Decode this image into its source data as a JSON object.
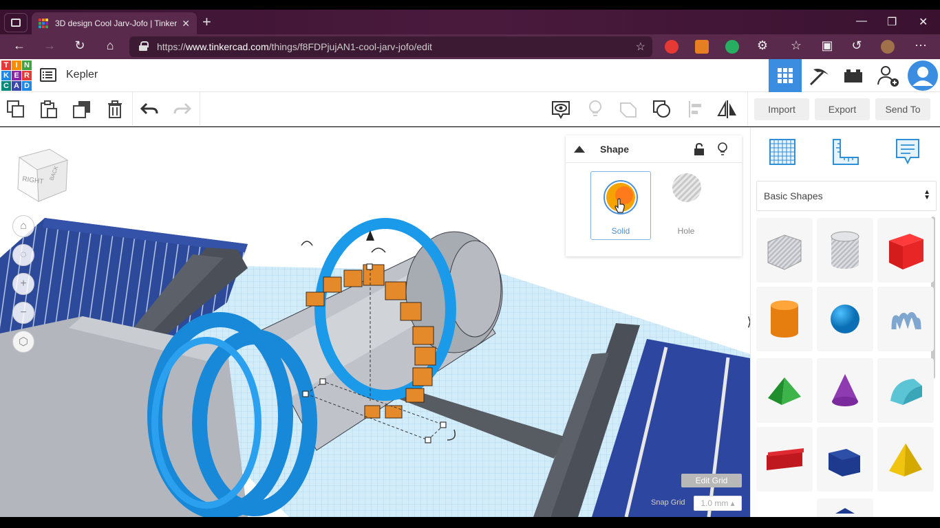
{
  "browser": {
    "tab_title": "3D design Cool Jarv-Jofo | Tinker",
    "url_prefix": "https://",
    "url_domain": "www.tinkercad.com",
    "url_path": "/things/f8FDPjujAN1-cool-jarv-jofo/edit"
  },
  "app": {
    "logo_letters": [
      "T",
      "I",
      "N",
      "K",
      "E",
      "R",
      "C",
      "A",
      "D"
    ],
    "design_name": "Kepler"
  },
  "toolbar": {
    "import_label": "Import",
    "export_label": "Export",
    "send_to_label": "Send To"
  },
  "viewcube": {
    "right_label": "RIGHT",
    "back_label": "BACK"
  },
  "shape_panel": {
    "title": "Shape",
    "solid_label": "Solid",
    "hole_label": "Hole"
  },
  "grid": {
    "edit_grid_label": "Edit Grid",
    "snap_grid_label": "Snap Grid",
    "snap_grid_value": "1.0 mm ▴"
  },
  "library": {
    "selected": "Basic Shapes",
    "tiles": [
      "Box (hole)",
      "Cylinder (hole)",
      "Box",
      "Cylinder",
      "Sphere",
      "Scribble",
      "Roof",
      "Cone",
      "Round Roof",
      "Text",
      "Polygon",
      "Pyramid"
    ]
  },
  "colors": {
    "accent_blue": "#3a8de0",
    "orange": "#ff8c1a",
    "workplane": "#cfe9f7"
  }
}
